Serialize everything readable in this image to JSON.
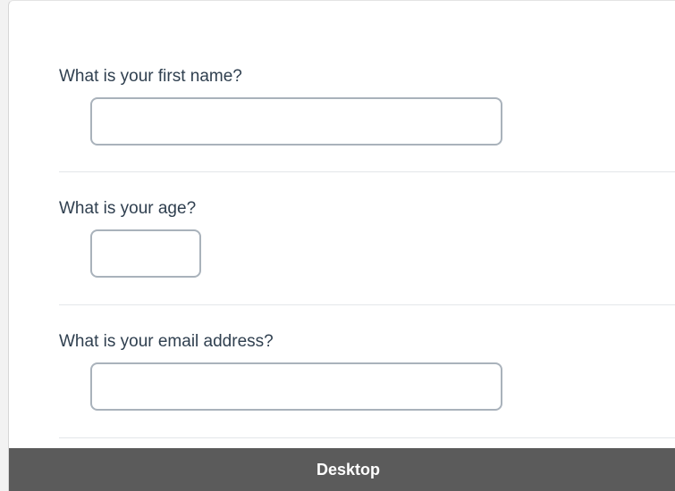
{
  "form": {
    "questions": [
      {
        "label": "What is your first name?",
        "value": ""
      },
      {
        "label": "What is your age?",
        "value": ""
      },
      {
        "label": "What is your email address?",
        "value": ""
      }
    ]
  },
  "footer": {
    "label": "Desktop"
  }
}
